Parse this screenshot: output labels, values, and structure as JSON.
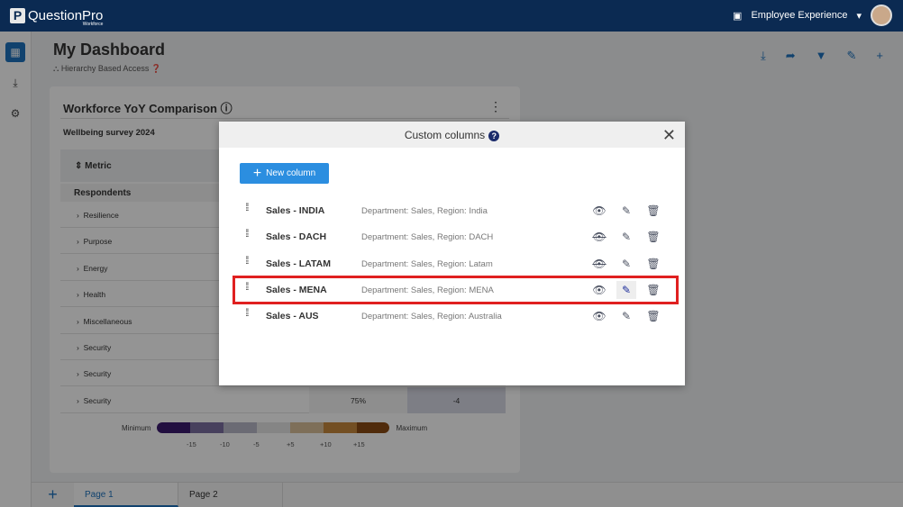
{
  "header": {
    "brand": "QuestionPro",
    "brand_sub": "Workforce",
    "product": "Employee Experience"
  },
  "page": {
    "title": "My Dashboard",
    "subtitle": "Hierarchy Based Access"
  },
  "widget": {
    "title": "Workforce YoY Comparison",
    "survey": "Wellbeing survey 2024",
    "metric_label": "Metric",
    "respondents_label": "Respondents",
    "rows": [
      "Resilience",
      "Purpose",
      "Energy",
      "Health",
      "Miscellaneous",
      "Security",
      "Security",
      "Security"
    ],
    "last_row_values": [
      "75%",
      "-4"
    ],
    "legend": {
      "min": "Minimum",
      "max": "Maximum",
      "ticks": [
        "-15",
        "-10",
        "-5",
        "+5",
        "+10",
        "+15"
      ],
      "colors": [
        "#3b1a6e",
        "#7a6fa0",
        "#b9b8c8",
        "#e6e6e6",
        "#d9c09a",
        "#c7893d",
        "#8a4a14"
      ]
    }
  },
  "tabs": [
    "Page 1",
    "Page 2"
  ],
  "modal": {
    "title": "Custom columns",
    "new_column": "New column",
    "columns": [
      {
        "name": "Sales - INDIA",
        "desc": "Department: Sales, Region: India",
        "visible": true
      },
      {
        "name": "Sales - DACH",
        "desc": "Department: Sales, Region: DACH",
        "visible": false
      },
      {
        "name": "Sales - LATAM",
        "desc": "Department: Sales, Region: Latam",
        "visible": false
      },
      {
        "name": "Sales - MENA",
        "desc": "Department: Sales, Region: MENA",
        "visible": true
      },
      {
        "name": "Sales - AUS",
        "desc": "Department: Sales, Region: Australia",
        "visible": true
      }
    ]
  }
}
